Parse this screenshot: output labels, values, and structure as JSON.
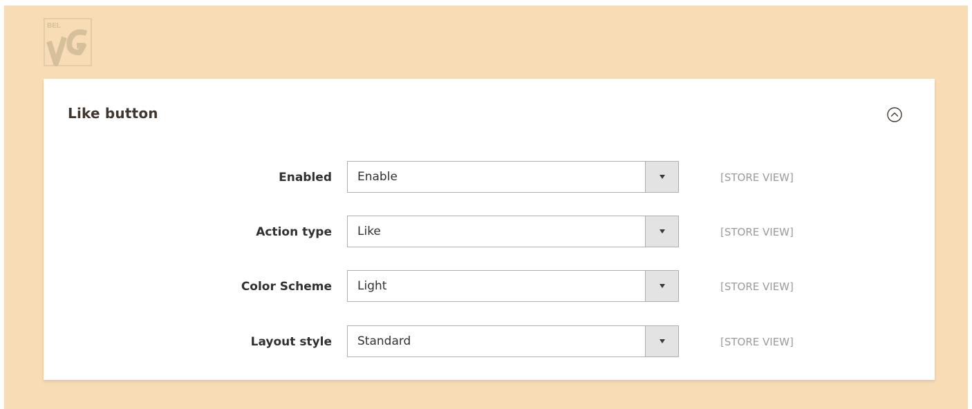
{
  "logo": {
    "icon": "belvg-logo-watermark",
    "text": "BELVG",
    "color": "#d9c4a3"
  },
  "panel": {
    "title": "Like button",
    "collapse_icon": "chevron-up-circle-icon"
  },
  "fields": [
    {
      "label": "Enabled",
      "value": "Enable",
      "scope": "[STORE VIEW]"
    },
    {
      "label": "Action type",
      "value": "Like",
      "scope": "[STORE VIEW]"
    },
    {
      "label": "Color Scheme",
      "value": "Light",
      "scope": "[STORE VIEW]"
    },
    {
      "label": "Layout style",
      "value": "Standard",
      "scope": "[STORE VIEW]"
    }
  ],
  "colors": {
    "background": "#f8dcb5",
    "panel": "#ffffff",
    "label_text": "#303030",
    "scope_text": "#9a9a9a",
    "select_border": "#adadad",
    "select_arrow_bg": "#e3e3e3"
  }
}
